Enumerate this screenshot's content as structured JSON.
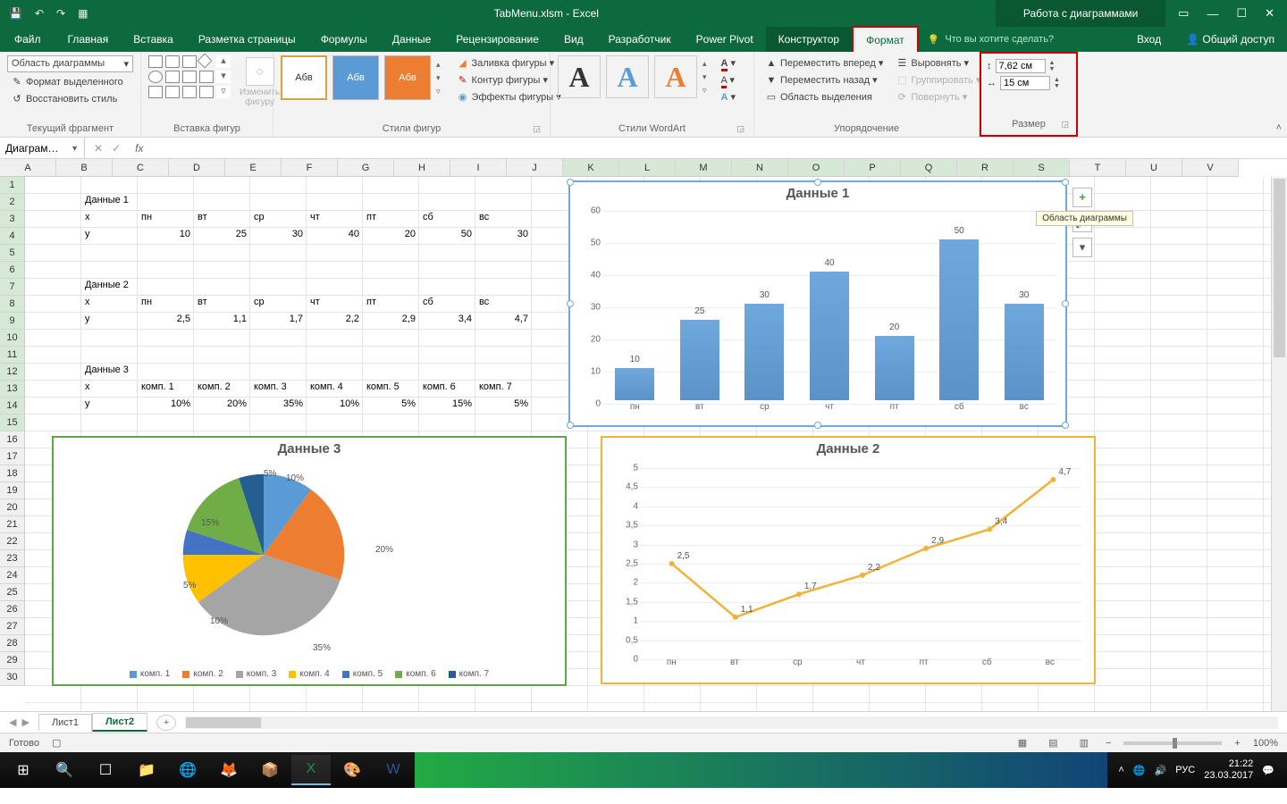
{
  "titlebar": {
    "doc_title": "TabMenu.xlsm - Excel",
    "tools_title": "Работа с диаграммами"
  },
  "tabs": {
    "file": "Файл",
    "list": [
      "Главная",
      "Вставка",
      "Разметка страницы",
      "Формулы",
      "Данные",
      "Рецензирование",
      "Вид",
      "Разработчик",
      "Power Pivot"
    ],
    "tools": [
      "Конструктор",
      "Формат"
    ],
    "active": "Формат",
    "tell_me": "Что вы хотите сделать?",
    "signin": "Вход",
    "share": "Общий доступ"
  },
  "ribbon": {
    "g1": {
      "label": "Текущий фрагмент",
      "selector": "Область диаграммы",
      "format_sel": "Формат выделенного",
      "reset": "Восстановить стиль"
    },
    "g2": {
      "label": "Вставка фигур",
      "change": "Изменить фигуру",
      "sample": "Абв"
    },
    "g3": {
      "label": "Стили фигур",
      "sample": "Абв",
      "fill": "Заливка фигуры",
      "outline": "Контур фигуры",
      "effects": "Эффекты фигуры"
    },
    "g4": {
      "label": "Стили WordArt"
    },
    "g5": {
      "label": "Упорядочение",
      "forward": "Переместить вперед",
      "backward": "Переместить назад",
      "selection": "Область выделения",
      "align": "Выровнять",
      "group": "Группировать",
      "rotate": "Повернуть"
    },
    "g6": {
      "label": "Размер",
      "height": "7,62 см",
      "width": "15 см"
    }
  },
  "formula": {
    "namebox": "Диаграм…"
  },
  "gridcols": [
    "A",
    "B",
    "C",
    "D",
    "E",
    "F",
    "G",
    "H",
    "I",
    "J",
    "K",
    "L",
    "M",
    "N",
    "O",
    "P",
    "Q",
    "R",
    "S",
    "T",
    "U",
    "V"
  ],
  "sheet": {
    "d1_title": "Данные 1",
    "x": "x",
    "y": "y",
    "days": [
      "пн",
      "вт",
      "ср",
      "чт",
      "пт",
      "сб",
      "вс"
    ],
    "d1_y": [
      10,
      25,
      30,
      40,
      20,
      50,
      30
    ],
    "d2_title": "Данные 2",
    "d2_y": [
      "2,5",
      "1,1",
      "1,7",
      "2,2",
      "2,9",
      "3,4",
      "4,7"
    ],
    "d3_title": "Данные 3",
    "comps": [
      "комп. 1",
      "комп. 2",
      "комп. 3",
      "комп. 4",
      "комп. 5",
      "комп. 6",
      "комп. 7"
    ],
    "d3_y": [
      "10%",
      "20%",
      "35%",
      "10%",
      "5%",
      "15%",
      "5%"
    ]
  },
  "chart_data": [
    {
      "type": "bar",
      "title": "Данные 1",
      "categories": [
        "пн",
        "вт",
        "ср",
        "чт",
        "пт",
        "сб",
        "вс"
      ],
      "values": [
        10,
        25,
        30,
        40,
        20,
        50,
        30
      ],
      "ylim": [
        0,
        60
      ],
      "yticks": [
        0,
        10,
        20,
        30,
        40,
        50,
        60
      ]
    },
    {
      "type": "line",
      "title": "Данные 2",
      "categories": [
        "пн",
        "вт",
        "ср",
        "чт",
        "пт",
        "сб",
        "вс"
      ],
      "values": [
        2.5,
        1.1,
        1.7,
        2.2,
        2.9,
        3.4,
        4.7
      ],
      "labels": [
        "2,5",
        "1,1",
        "1,7",
        "2,2",
        "2,9",
        "3,4",
        "4,7"
      ],
      "ylim": [
        0,
        5
      ],
      "yticks": [
        0,
        0.5,
        1,
        1.5,
        2,
        2.5,
        3,
        3.5,
        4,
        4.5,
        5
      ],
      "ytick_labels": [
        "0",
        "0,5",
        "1",
        "1,5",
        "2",
        "2,5",
        "3",
        "3,5",
        "4",
        "4,5",
        "5"
      ]
    },
    {
      "type": "pie",
      "title": "Данные 3",
      "categories": [
        "комп. 1",
        "комп. 2",
        "комп. 3",
        "комп. 4",
        "комп. 5",
        "комп. 6",
        "комп. 7"
      ],
      "values": [
        10,
        20,
        35,
        10,
        5,
        15,
        5
      ],
      "labels": [
        "10%",
        "20%",
        "35%",
        "10%",
        "5%",
        "15%",
        "5%"
      ],
      "colors": [
        "#5b9bd5",
        "#ed7d31",
        "#a5a5a5",
        "#ffc000",
        "#4472c4",
        "#70ad47",
        "#255e91"
      ]
    }
  ],
  "chart_tooltip": "Область диаграммы",
  "sheets": {
    "list": [
      "Лист1",
      "Лист2"
    ],
    "active": "Лист2"
  },
  "status": {
    "ready": "Готово",
    "zoom": "100%"
  },
  "tray": {
    "lang": "РУС",
    "time": "21:22",
    "date": "23.03.2017"
  }
}
